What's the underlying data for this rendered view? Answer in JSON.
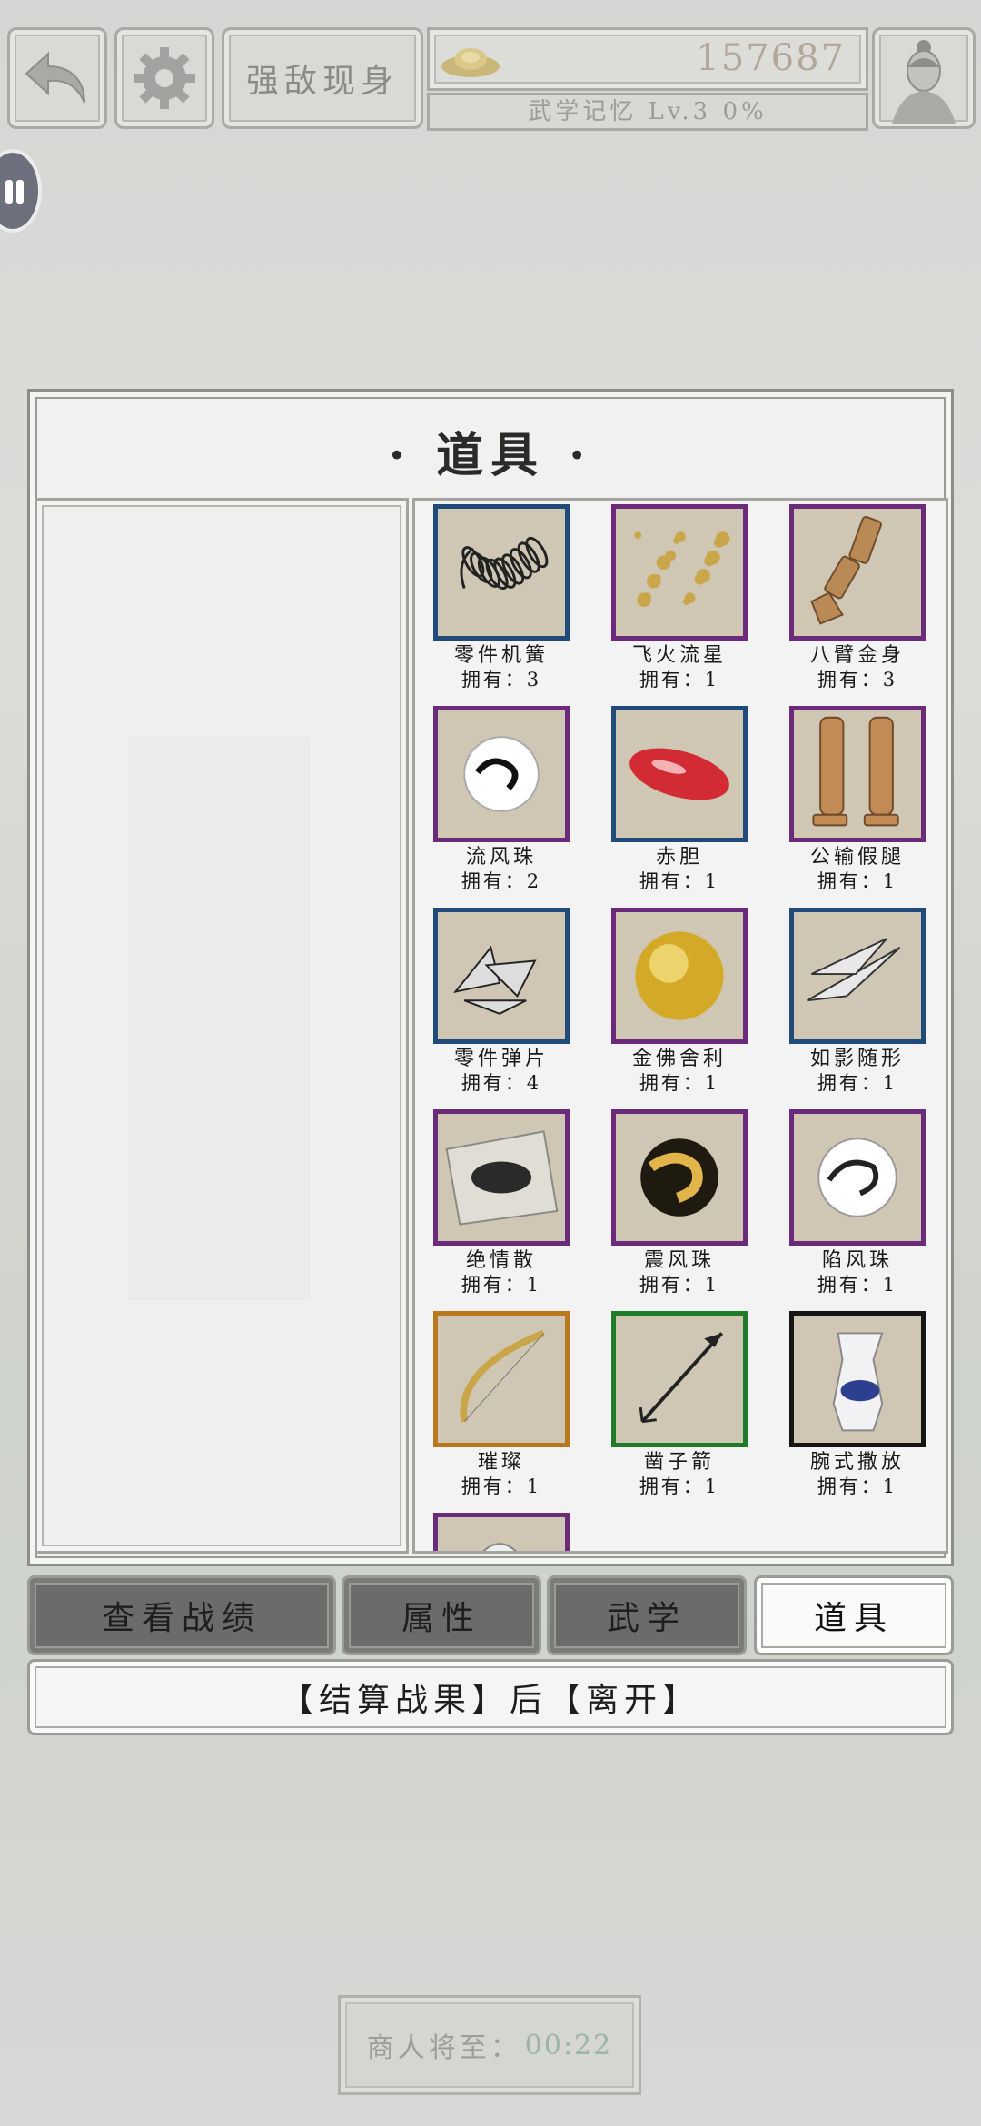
{
  "header": {
    "mode_title": "强敌现身",
    "currency_amount": "157687",
    "level_text": "武学记忆 Lv.3 0%"
  },
  "panel": {
    "title": "· 道具 ·"
  },
  "items": [
    {
      "name": "零件机簧",
      "count": "拥有：3",
      "rarity": "blue",
      "icon": "spring-icon"
    },
    {
      "name": "飞火流星",
      "count": "拥有：1",
      "rarity": "purple",
      "icon": "sparks-icon"
    },
    {
      "name": "八臂金身",
      "count": "拥有：3",
      "rarity": "purple",
      "icon": "wooden-arm-icon"
    },
    {
      "name": "流风珠",
      "count": "拥有：2",
      "rarity": "purple",
      "icon": "wind-pearl-icon"
    },
    {
      "name": "赤胆",
      "count": "拥有：1",
      "rarity": "blue",
      "icon": "red-gall-icon"
    },
    {
      "name": "公输假腿",
      "count": "拥有：1",
      "rarity": "purple",
      "icon": "wooden-leg-icon"
    },
    {
      "name": "零件弹片",
      "count": "拥有：4",
      "rarity": "blue",
      "icon": "shrapnel-icon"
    },
    {
      "name": "金佛舍利",
      "count": "拥有：1",
      "rarity": "purple",
      "icon": "golden-relic-icon"
    },
    {
      "name": "如影随形",
      "count": "拥有：1",
      "rarity": "blue",
      "icon": "shadow-blade-icon"
    },
    {
      "name": "绝情散",
      "count": "拥有：1",
      "rarity": "purple",
      "icon": "poison-powder-icon"
    },
    {
      "name": "震风珠",
      "count": "拥有：1",
      "rarity": "purple",
      "icon": "thunder-pearl-icon"
    },
    {
      "name": "陷风珠",
      "count": "拥有：1",
      "rarity": "purple",
      "icon": "trap-pearl-icon"
    },
    {
      "name": "璀璨",
      "count": "拥有：1",
      "rarity": "orange",
      "icon": "bow-icon"
    },
    {
      "name": "凿子箭",
      "count": "拥有：1",
      "rarity": "green",
      "icon": "arrow-icon"
    },
    {
      "name": "腕式撒放",
      "count": "拥有：1",
      "rarity": "black",
      "icon": "wrist-release-icon"
    },
    {
      "name": "",
      "count": "",
      "rarity": "purple",
      "icon": "partial-item-icon"
    }
  ],
  "tabs": [
    {
      "label": "查看战绩",
      "active": false
    },
    {
      "label": "属性",
      "active": false
    },
    {
      "label": "武学",
      "active": false
    },
    {
      "label": "道具",
      "active": true
    }
  ],
  "settle_button": "【结算战果】后【离开】",
  "merchant": {
    "label": "商人将至：",
    "time": "00:22"
  },
  "colors": {
    "blue": "#1f4a7a",
    "purple": "#6b2a7a",
    "orange": "#b8781e",
    "green": "#1f7a2a",
    "black": "#151515"
  }
}
